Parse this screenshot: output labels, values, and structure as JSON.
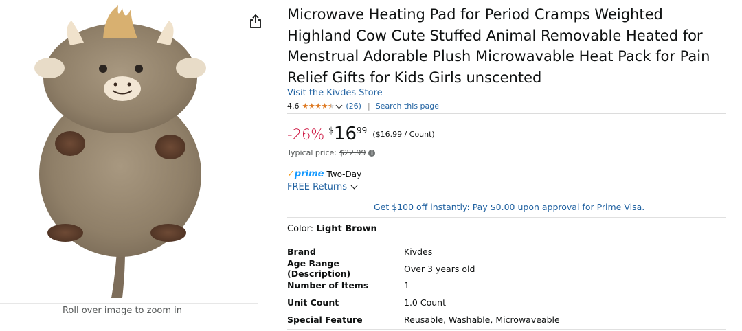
{
  "product": {
    "title": "Microwave Heating Pad for Period Cramps Weighted Highland Cow Cute Stuffed Animal Removable Heated for Menstrual Adorable Plush Microwavable Heat Pack for Pain Relief Gifts for Kids Girls unscented",
    "store_link": "Visit the Kivdes Store",
    "zoom_hint": "Roll over image to zoom in",
    "rating": {
      "value": "4.6",
      "count": "(26)",
      "separator": "|",
      "search_link": "Search this page"
    },
    "price": {
      "discount": "-26%",
      "currency": "$",
      "whole": "16",
      "fraction": "99",
      "per_unit": "($16.99 / Count)",
      "typical_label": "Typical price:",
      "typical_value": "$22.99"
    },
    "delivery": {
      "prime_label": "prime",
      "two_day": "Two-Day",
      "free_returns": "FREE Returns"
    },
    "promo": "Get $100 off instantly: Pay $0.00 upon approval for Prime Visa.",
    "color": {
      "label": "Color:",
      "value": "Light Brown"
    },
    "specs": [
      {
        "key": "Brand",
        "value": "Kivdes"
      },
      {
        "key": "Age Range (Description)",
        "value": "Over 3 years old"
      },
      {
        "key": "Number of Items",
        "value": "1"
      },
      {
        "key": "Unit Count",
        "value": "1.0 Count"
      },
      {
        "key": "Special Feature",
        "value": "Reusable, Washable, Microwaveable"
      }
    ]
  },
  "icons": {
    "share": "share-icon",
    "info": "info-icon",
    "chevron": "chevron-down-icon",
    "prime_check": "prime-check-icon"
  },
  "colors": {
    "link": "#2162a1",
    "discount": "#cc0c39",
    "star": "#de7921",
    "prime_blue": "#1399ff",
    "prime_orange": "#f49d23"
  }
}
